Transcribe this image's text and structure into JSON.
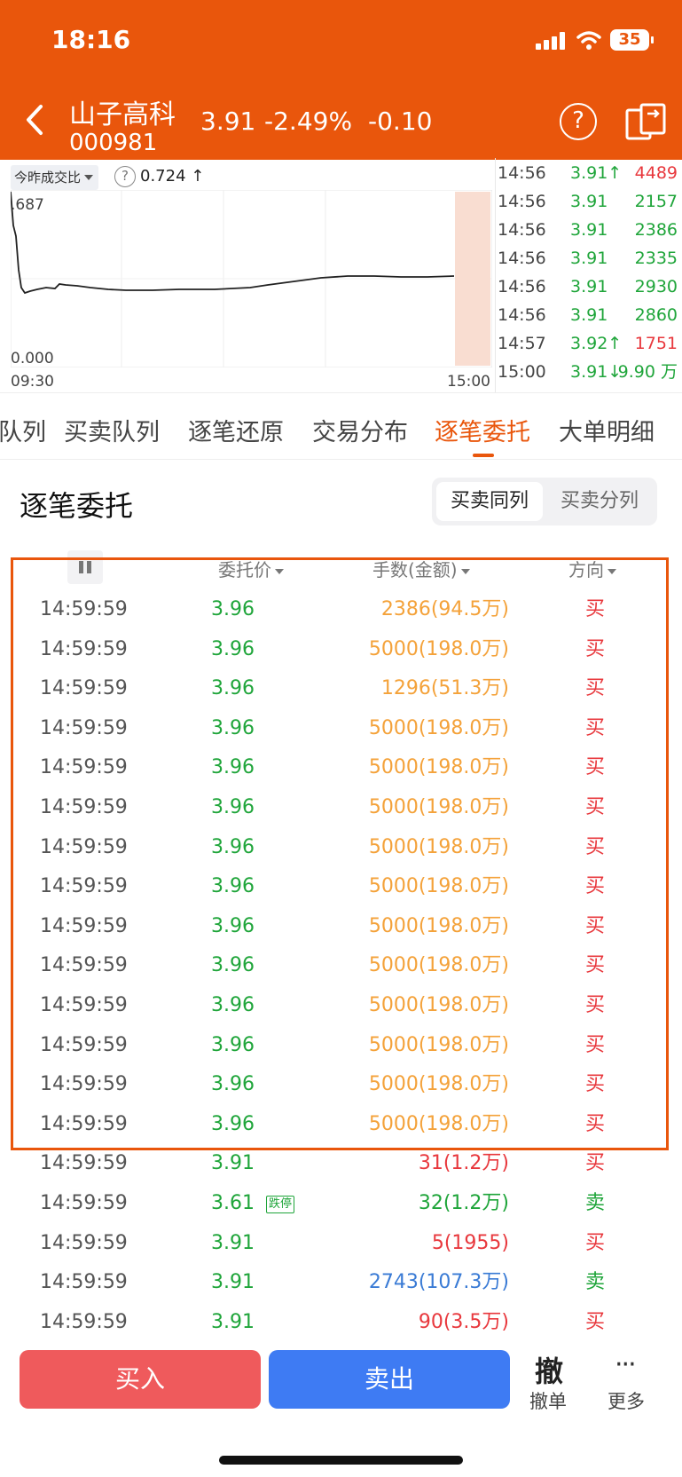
{
  "status_bar": {
    "time": "18:16",
    "battery": "35"
  },
  "header": {
    "stock_name": "山子高科",
    "stock_code": "000981",
    "price": "3.91",
    "change_pct": "-2.49%",
    "change": "-0.10",
    "help_glyph": "?"
  },
  "chart": {
    "ratio_label": "今昨成交比",
    "help_glyph": "?",
    "ratio_value": "0.724 ↑",
    "y_top": ".687",
    "y_bottom": "0.000",
    "x_start": "09:30",
    "x_end": "15:00"
  },
  "ticks": [
    {
      "time": "14:56",
      "price": "3.91↑",
      "volume": "4489",
      "vol_color": "red"
    },
    {
      "time": "14:56",
      "price": "3.91",
      "volume": "2157",
      "vol_color": "green"
    },
    {
      "time": "14:56",
      "price": "3.91",
      "volume": "2386",
      "vol_color": "green"
    },
    {
      "time": "14:56",
      "price": "3.91",
      "volume": "2335",
      "vol_color": "green"
    },
    {
      "time": "14:56",
      "price": "3.91",
      "volume": "2930",
      "vol_color": "green"
    },
    {
      "time": "14:56",
      "price": "3.91",
      "volume": "2860",
      "vol_color": "green"
    },
    {
      "time": "14:57",
      "price": "3.92↑",
      "volume": "1751",
      "vol_color": "red"
    },
    {
      "time": "15:00",
      "price": "3.91↓",
      "volume": "9.90 万",
      "vol_color": "green"
    }
  ],
  "tabs": [
    {
      "label": "队列"
    },
    {
      "label": "买卖队列"
    },
    {
      "label": "逐笔还原"
    },
    {
      "label": "交易分布"
    },
    {
      "label": "逐笔委托"
    },
    {
      "label": "大单明细"
    }
  ],
  "section": {
    "title": "逐笔委托",
    "seg_same": "买卖同列",
    "seg_split": "买卖分列"
  },
  "table": {
    "headers": {
      "price": "委托价",
      "amount": "手数(金额)",
      "direction": "方向"
    },
    "rows": [
      {
        "time": "14:59:59",
        "price": "3.96",
        "amount": "2386(94.5万)",
        "dir": "买",
        "amt_color": "orange",
        "dir_color": "red"
      },
      {
        "time": "14:59:59",
        "price": "3.96",
        "amount": "5000(198.0万)",
        "dir": "买",
        "amt_color": "orange",
        "dir_color": "red"
      },
      {
        "time": "14:59:59",
        "price": "3.96",
        "amount": "1296(51.3万)",
        "dir": "买",
        "amt_color": "orange",
        "dir_color": "red"
      },
      {
        "time": "14:59:59",
        "price": "3.96",
        "amount": "5000(198.0万)",
        "dir": "买",
        "amt_color": "orange",
        "dir_color": "red"
      },
      {
        "time": "14:59:59",
        "price": "3.96",
        "amount": "5000(198.0万)",
        "dir": "买",
        "amt_color": "orange",
        "dir_color": "red"
      },
      {
        "time": "14:59:59",
        "price": "3.96",
        "amount": "5000(198.0万)",
        "dir": "买",
        "amt_color": "orange",
        "dir_color": "red"
      },
      {
        "time": "14:59:59",
        "price": "3.96",
        "amount": "5000(198.0万)",
        "dir": "买",
        "amt_color": "orange",
        "dir_color": "red"
      },
      {
        "time": "14:59:59",
        "price": "3.96",
        "amount": "5000(198.0万)",
        "dir": "买",
        "amt_color": "orange",
        "dir_color": "red"
      },
      {
        "time": "14:59:59",
        "price": "3.96",
        "amount": "5000(198.0万)",
        "dir": "买",
        "amt_color": "orange",
        "dir_color": "red"
      },
      {
        "time": "14:59:59",
        "price": "3.96",
        "amount": "5000(198.0万)",
        "dir": "买",
        "amt_color": "orange",
        "dir_color": "red"
      },
      {
        "time": "14:59:59",
        "price": "3.96",
        "amount": "5000(198.0万)",
        "dir": "买",
        "amt_color": "orange",
        "dir_color": "red"
      },
      {
        "time": "14:59:59",
        "price": "3.96",
        "amount": "5000(198.0万)",
        "dir": "买",
        "amt_color": "orange",
        "dir_color": "red"
      },
      {
        "time": "14:59:59",
        "price": "3.96",
        "amount": "5000(198.0万)",
        "dir": "买",
        "amt_color": "orange",
        "dir_color": "red"
      },
      {
        "time": "14:59:59",
        "price": "3.96",
        "amount": "5000(198.0万)",
        "dir": "买",
        "amt_color": "orange",
        "dir_color": "red"
      },
      {
        "time": "14:59:59",
        "price": "3.91",
        "amount": "31(1.2万)",
        "dir": "买",
        "amt_color": "red",
        "dir_color": "red"
      },
      {
        "time": "14:59:59",
        "price": "3.61",
        "limit": "跌停",
        "amount": "32(1.2万)",
        "dir": "卖",
        "amt_color": "green",
        "dir_color": "green"
      },
      {
        "time": "14:59:59",
        "price": "3.91",
        "amount": "5(1955)",
        "dir": "买",
        "amt_color": "red",
        "dir_color": "red"
      },
      {
        "time": "14:59:59",
        "price": "3.91",
        "amount": "2743(107.3万)",
        "dir": "卖",
        "amt_color": "blue",
        "dir_color": "green"
      },
      {
        "time": "14:59:59",
        "price": "3.91",
        "amount": "90(3.5万)",
        "dir": "买",
        "amt_color": "red",
        "dir_color": "red"
      }
    ]
  },
  "bottom": {
    "buy": "买入",
    "sell": "卖出",
    "cancel_icon": "撤",
    "cancel": "撤单",
    "more_icon": "···",
    "more": "更多"
  },
  "colors": {
    "brand": "#e9560c",
    "up": "#e8383d",
    "down": "#1fa53a",
    "buy_btn": "#ef5a5c",
    "sell_btn": "#3e7bf3"
  }
}
